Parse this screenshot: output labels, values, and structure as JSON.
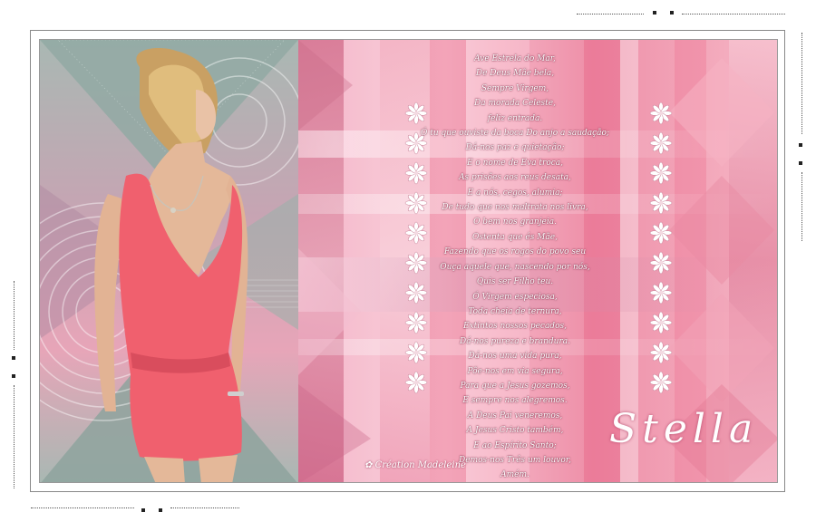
{
  "artwork": {
    "title": "Ave Estrela do Mar",
    "poem_lines": [
      "Ave Estrela do Mar,",
      "De Deus Mãe bela,",
      "Sempre Virgem,",
      "Da morada Celeste,",
      "feliz entrada.",
      "Ó tu que ouviste da boca Do anjo a saudação;",
      "Dá-nos paz e quietação;",
      "E o nome de Eva troca,",
      "As prisões aos reus desata,",
      "E a nós, cegos, alumia;",
      "De tudo que nos maltrata nos livra,",
      "O bem nos granjeia.",
      "Ostenta que és Mãe,",
      "Fazendo que os rogos do povo seu",
      "Ouça aquele que, nascendo por nós,",
      "Quis ser Filho teu.",
      "Ó Virgem especiosa,",
      "Toda cheia de ternura,",
      "Extintos nossos pecados,",
      "Dá-nos pureza e brandura.",
      "Dá-nos uma vida pura,",
      "Põe-nos em via segura,",
      "Para que a Jesus gozemos,",
      "E sempre nos alegremos.",
      "A Deus Pai veneremos,",
      "A Jesus Cristo também,",
      "E ao Espírito Santo;",
      "Demos-nos Três um louvor,",
      "Amém."
    ],
    "signature": "Stella",
    "credit": "Création Madeleine",
    "colors": {
      "primary_pink": "#ee7d8e",
      "dress": "#f0606e",
      "teal_gray": "#8fa6a1",
      "white": "#ffffff"
    },
    "icons": [
      "flower-icon"
    ]
  }
}
